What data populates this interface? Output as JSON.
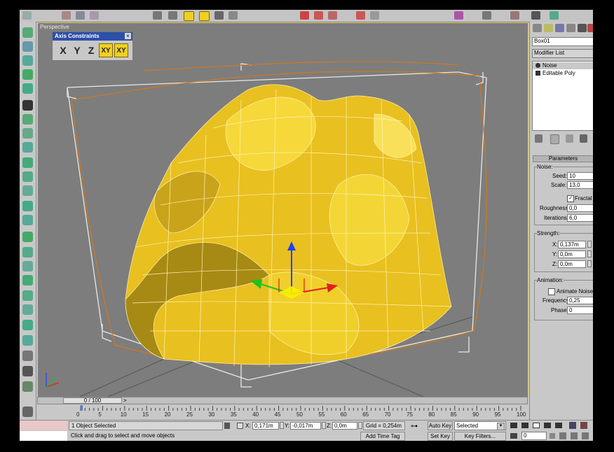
{
  "viewport": {
    "label": "Perspective"
  },
  "axis_constraints": {
    "title": "Axis Constraints",
    "close": "×",
    "buttons": [
      "X",
      "Y",
      "Z",
      "XY",
      "XY"
    ]
  },
  "command_panel": {
    "object_name": "Box01",
    "modifier_list": "Modifier List",
    "stack": [
      "Noise",
      "Editable Poly"
    ],
    "parameters_title": "Parameters",
    "noise_group": "Noise:",
    "seed_label": "Seed:",
    "seed_value": "10",
    "scale_label": "Scale:",
    "scale_value": "13,0",
    "fractal_label": "Fractal",
    "roughness_label": "Roughness:",
    "roughness_value": "0,0",
    "iterations_label": "Iterations:",
    "iterations_value": "6,0",
    "strength_group": "Strength:",
    "x_label": "X:",
    "x_value": "0,137m",
    "y_label": "Y:",
    "y_value": "0,0m",
    "z_label": "Z:",
    "z_value": "0,0m",
    "animation_group": "Animation:",
    "animate_noise_label": "Animate Noise",
    "frequency_label": "Frequency:",
    "frequency_value": "0,25",
    "phase_label": "Phase:",
    "phase_value": "0"
  },
  "time_slider": {
    "label": "0 / 100",
    "arrow_left": "<",
    "arrow_right": ">"
  },
  "track_ticks": [
    "0",
    "5",
    "10",
    "15",
    "20",
    "25",
    "30",
    "35",
    "40",
    "45",
    "50",
    "55",
    "60",
    "65",
    "70",
    "75",
    "80",
    "85",
    "90",
    "95",
    "100"
  ],
  "status": {
    "selection": "1 Object Selected",
    "prompt": "Click and drag to select and move objects",
    "x_label": "X:",
    "x_value": "0,171m",
    "y_label": "Y:",
    "y_value": "-0,017m",
    "z_label": "Z:",
    "z_value": "0,0m",
    "grid": "Grid = 0,254m",
    "add_time_tag": "Add Time Tag",
    "auto_key": "Auto Key",
    "set_key": "Set Key",
    "selected": "Selected",
    "key_filters": "Key Filters...",
    "frame_value": "0"
  },
  "colors": {
    "mesh": "#e8c020",
    "viewport_bg": "#7d7d7d",
    "title_bar": "#2c4fa8"
  }
}
